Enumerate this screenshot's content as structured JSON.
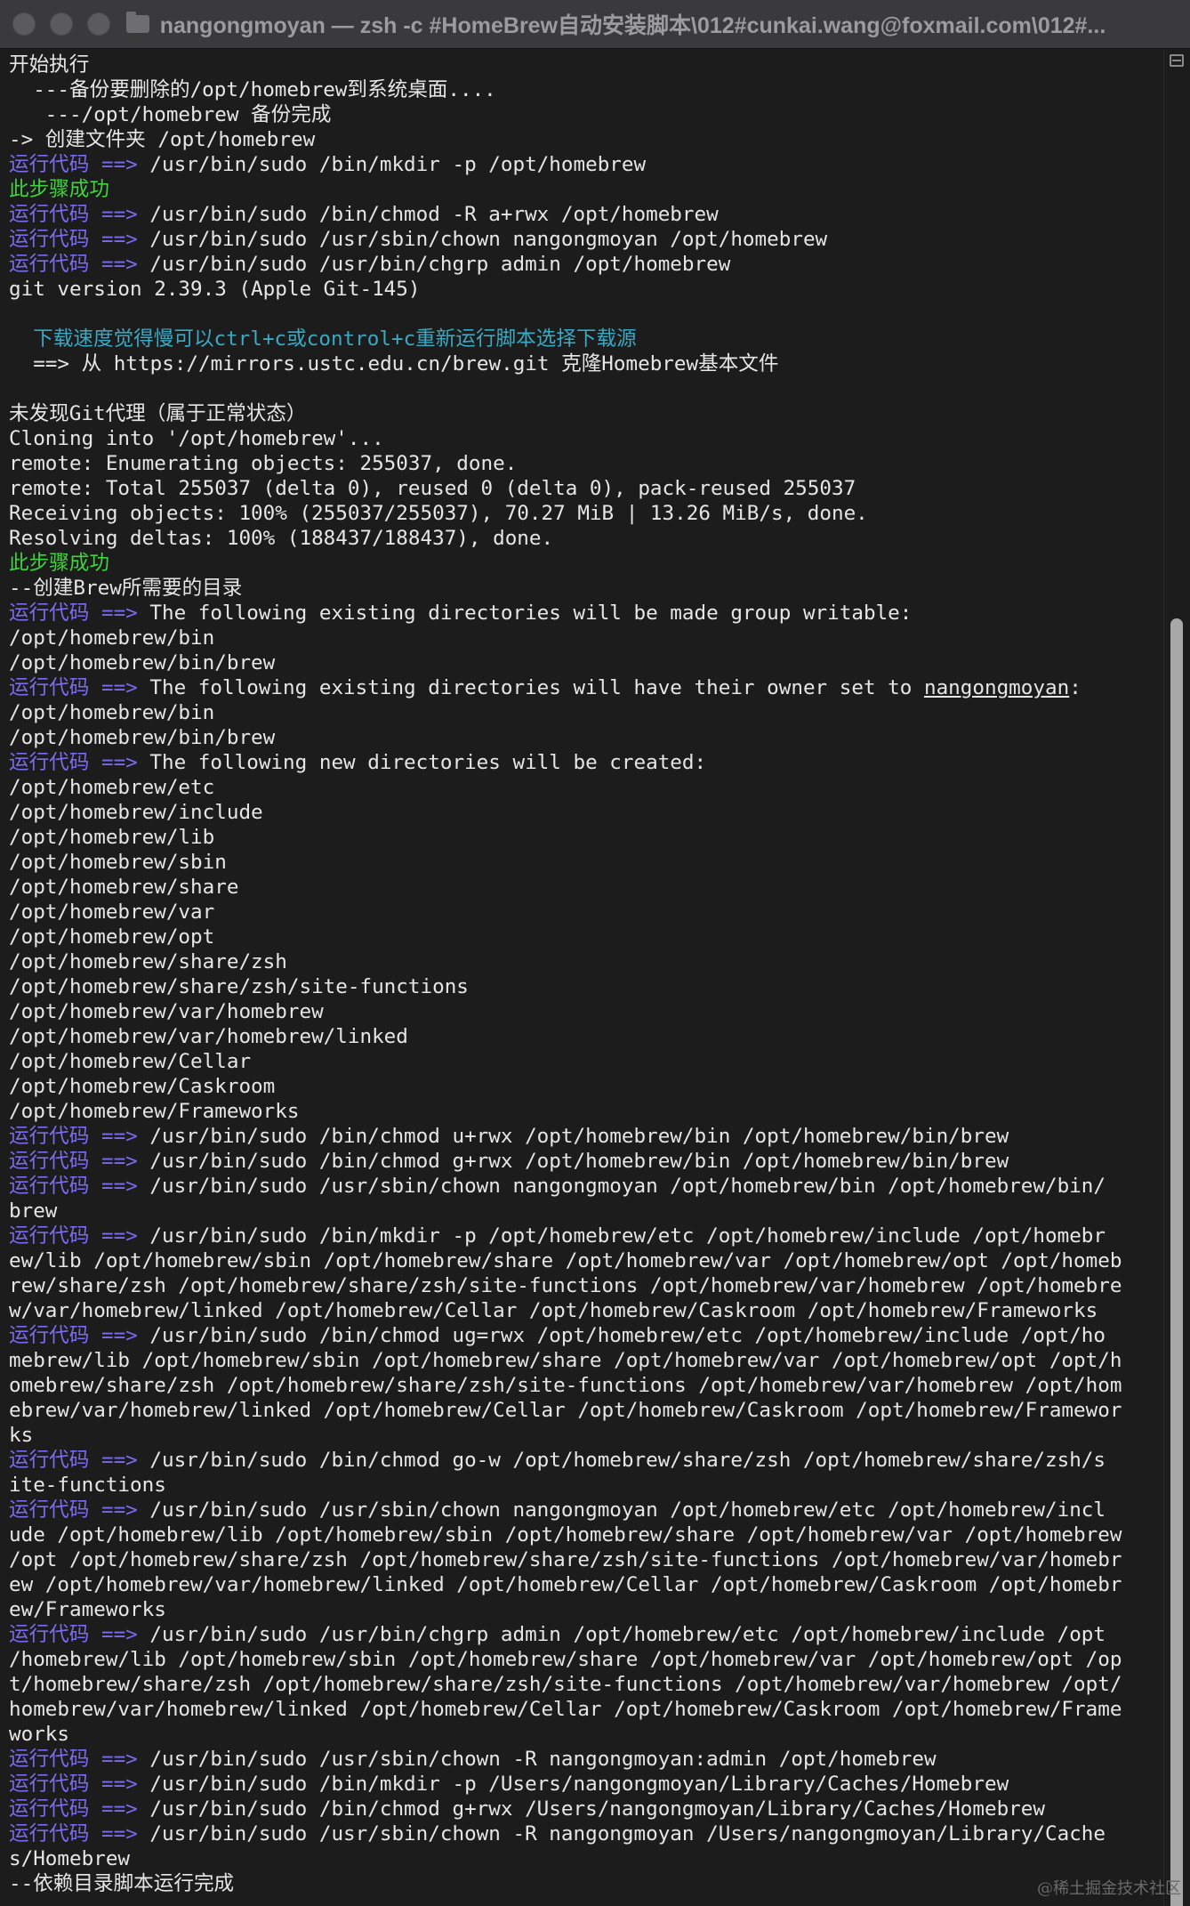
{
  "window": {
    "title": "nangongmoyan — zsh -c #HomeBrew自动安装脚本\\012#cunkai.wang@foxmail.com\\012#..."
  },
  "terminal": {
    "prompt_label": "运行代码 ==>",
    "lines": [
      [
        {
          "t": "开始执行",
          "c": "w"
        }
      ],
      [
        {
          "t": "  ---备份要删除的/opt/homebrew到系统桌面....",
          "c": "w"
        }
      ],
      [
        {
          "t": "   ---/opt/homebrew 备份完成",
          "c": "w"
        }
      ],
      [
        {
          "t": "-> 创建文件夹 /opt/homebrew",
          "c": "w"
        }
      ],
      [
        {
          "t": "运行代码 ==>",
          "c": "p"
        },
        {
          "t": " /usr/bin/sudo /bin/mkdir -p /opt/homebrew",
          "c": "w"
        }
      ],
      [
        {
          "t": "此步骤成功",
          "c": "g"
        }
      ],
      [
        {
          "t": "运行代码 ==>",
          "c": "p"
        },
        {
          "t": " /usr/bin/sudo /bin/chmod -R a+rwx /opt/homebrew",
          "c": "w"
        }
      ],
      [
        {
          "t": "运行代码 ==>",
          "c": "p"
        },
        {
          "t": " /usr/bin/sudo /usr/sbin/chown nangongmoyan /opt/homebrew",
          "c": "w"
        }
      ],
      [
        {
          "t": "运行代码 ==>",
          "c": "p"
        },
        {
          "t": " /usr/bin/sudo /usr/bin/chgrp admin /opt/homebrew",
          "c": "w"
        }
      ],
      [
        {
          "t": "git version 2.39.3 (Apple Git-145)",
          "c": "w"
        }
      ],
      [
        {
          "t": "",
          "c": "w"
        }
      ],
      [
        {
          "t": "  下载速度觉得慢可以ctrl+c或control+c重新运行脚本选择下载源",
          "c": "c"
        }
      ],
      [
        {
          "t": "  ==> 从 https://mirrors.ustc.edu.cn/brew.git 克隆Homebrew基本文件",
          "c": "w"
        }
      ],
      [
        {
          "t": "",
          "c": "w"
        }
      ],
      [
        {
          "t": "未发现Git代理（属于正常状态）",
          "c": "w"
        }
      ],
      [
        {
          "t": "Cloning into '/opt/homebrew'...",
          "c": "w"
        }
      ],
      [
        {
          "t": "remote: Enumerating objects: 255037, done.",
          "c": "w"
        }
      ],
      [
        {
          "t": "remote: Total 255037 (delta 0), reused 0 (delta 0), pack-reused 255037",
          "c": "w"
        }
      ],
      [
        {
          "t": "Receiving objects: 100% (255037/255037), 70.27 MiB | 13.26 MiB/s, done.",
          "c": "w"
        }
      ],
      [
        {
          "t": "Resolving deltas: 100% (188437/188437), done.",
          "c": "w"
        }
      ],
      [
        {
          "t": "此步骤成功",
          "c": "g"
        }
      ],
      [
        {
          "t": "--创建Brew所需要的目录",
          "c": "w"
        }
      ],
      [
        {
          "t": "运行代码 ==>",
          "c": "p"
        },
        {
          "t": " The following existing directories will be made group writable:",
          "c": "w"
        }
      ],
      [
        {
          "t": "/opt/homebrew/bin",
          "c": "w"
        }
      ],
      [
        {
          "t": "/opt/homebrew/bin/brew",
          "c": "w"
        }
      ],
      [
        {
          "t": "运行代码 ==>",
          "c": "p"
        },
        {
          "t": " The following existing directories will have their owner set to ",
          "c": "w"
        },
        {
          "t": "nangongmoyan",
          "c": "u"
        },
        {
          "t": ":",
          "c": "w"
        }
      ],
      [
        {
          "t": "/opt/homebrew/bin",
          "c": "w"
        }
      ],
      [
        {
          "t": "/opt/homebrew/bin/brew",
          "c": "w"
        }
      ],
      [
        {
          "t": "运行代码 ==>",
          "c": "p"
        },
        {
          "t": " The following new directories will be created:",
          "c": "w"
        }
      ],
      [
        {
          "t": "/opt/homebrew/etc",
          "c": "w"
        }
      ],
      [
        {
          "t": "/opt/homebrew/include",
          "c": "w"
        }
      ],
      [
        {
          "t": "/opt/homebrew/lib",
          "c": "w"
        }
      ],
      [
        {
          "t": "/opt/homebrew/sbin",
          "c": "w"
        }
      ],
      [
        {
          "t": "/opt/homebrew/share",
          "c": "w"
        }
      ],
      [
        {
          "t": "/opt/homebrew/var",
          "c": "w"
        }
      ],
      [
        {
          "t": "/opt/homebrew/opt",
          "c": "w"
        }
      ],
      [
        {
          "t": "/opt/homebrew/share/zsh",
          "c": "w"
        }
      ],
      [
        {
          "t": "/opt/homebrew/share/zsh/site-functions",
          "c": "w"
        }
      ],
      [
        {
          "t": "/opt/homebrew/var/homebrew",
          "c": "w"
        }
      ],
      [
        {
          "t": "/opt/homebrew/var/homebrew/linked",
          "c": "w"
        }
      ],
      [
        {
          "t": "/opt/homebrew/Cellar",
          "c": "w"
        }
      ],
      [
        {
          "t": "/opt/homebrew/Caskroom",
          "c": "w"
        }
      ],
      [
        {
          "t": "/opt/homebrew/Frameworks",
          "c": "w"
        }
      ],
      [
        {
          "t": "运行代码 ==>",
          "c": "p"
        },
        {
          "t": " /usr/bin/sudo /bin/chmod u+rwx /opt/homebrew/bin /opt/homebrew/bin/brew",
          "c": "w"
        }
      ],
      [
        {
          "t": "运行代码 ==>",
          "c": "p"
        },
        {
          "t": " /usr/bin/sudo /bin/chmod g+rwx /opt/homebrew/bin /opt/homebrew/bin/brew",
          "c": "w"
        }
      ],
      [
        {
          "t": "运行代码 ==>",
          "c": "p"
        },
        {
          "t": " /usr/bin/sudo /usr/sbin/chown nangongmoyan /opt/homebrew/bin /opt/homebrew/bin/",
          "c": "w"
        }
      ],
      [
        {
          "t": "brew",
          "c": "w"
        }
      ],
      [
        {
          "t": "运行代码 ==>",
          "c": "p"
        },
        {
          "t": " /usr/bin/sudo /bin/mkdir -p /opt/homebrew/etc /opt/homebrew/include /opt/homebr",
          "c": "w"
        }
      ],
      [
        {
          "t": "ew/lib /opt/homebrew/sbin /opt/homebrew/share /opt/homebrew/var /opt/homebrew/opt /opt/homeb",
          "c": "w"
        }
      ],
      [
        {
          "t": "rew/share/zsh /opt/homebrew/share/zsh/site-functions /opt/homebrew/var/homebrew /opt/homebre",
          "c": "w"
        }
      ],
      [
        {
          "t": "w/var/homebrew/linked /opt/homebrew/Cellar /opt/homebrew/Caskroom /opt/homebrew/Frameworks",
          "c": "w"
        }
      ],
      [
        {
          "t": "运行代码 ==>",
          "c": "p"
        },
        {
          "t": " /usr/bin/sudo /bin/chmod ug=rwx /opt/homebrew/etc /opt/homebrew/include /opt/ho",
          "c": "w"
        }
      ],
      [
        {
          "t": "mebrew/lib /opt/homebrew/sbin /opt/homebrew/share /opt/homebrew/var /opt/homebrew/opt /opt/h",
          "c": "w"
        }
      ],
      [
        {
          "t": "omebrew/share/zsh /opt/homebrew/share/zsh/site-functions /opt/homebrew/var/homebrew /opt/hom",
          "c": "w"
        }
      ],
      [
        {
          "t": "ebrew/var/homebrew/linked /opt/homebrew/Cellar /opt/homebrew/Caskroom /opt/homebrew/Framewor",
          "c": "w"
        }
      ],
      [
        {
          "t": "ks",
          "c": "w"
        }
      ],
      [
        {
          "t": "运行代码 ==>",
          "c": "p"
        },
        {
          "t": " /usr/bin/sudo /bin/chmod go-w /opt/homebrew/share/zsh /opt/homebrew/share/zsh/s",
          "c": "w"
        }
      ],
      [
        {
          "t": "ite-functions",
          "c": "w"
        }
      ],
      [
        {
          "t": "运行代码 ==>",
          "c": "p"
        },
        {
          "t": " /usr/bin/sudo /usr/sbin/chown nangongmoyan /opt/homebrew/etc /opt/homebrew/incl",
          "c": "w"
        }
      ],
      [
        {
          "t": "ude /opt/homebrew/lib /opt/homebrew/sbin /opt/homebrew/share /opt/homebrew/var /opt/homebrew",
          "c": "w"
        }
      ],
      [
        {
          "t": "/opt /opt/homebrew/share/zsh /opt/homebrew/share/zsh/site-functions /opt/homebrew/var/homebr",
          "c": "w"
        }
      ],
      [
        {
          "t": "ew /opt/homebrew/var/homebrew/linked /opt/homebrew/Cellar /opt/homebrew/Caskroom /opt/homebr",
          "c": "w"
        }
      ],
      [
        {
          "t": "ew/Frameworks",
          "c": "w"
        }
      ],
      [
        {
          "t": "运行代码 ==>",
          "c": "p"
        },
        {
          "t": " /usr/bin/sudo /usr/bin/chgrp admin /opt/homebrew/etc /opt/homebrew/include /opt",
          "c": "w"
        }
      ],
      [
        {
          "t": "/homebrew/lib /opt/homebrew/sbin /opt/homebrew/share /opt/homebrew/var /opt/homebrew/opt /op",
          "c": "w"
        }
      ],
      [
        {
          "t": "t/homebrew/share/zsh /opt/homebrew/share/zsh/site-functions /opt/homebrew/var/homebrew /opt/",
          "c": "w"
        }
      ],
      [
        {
          "t": "homebrew/var/homebrew/linked /opt/homebrew/Cellar /opt/homebrew/Caskroom /opt/homebrew/Frame",
          "c": "w"
        }
      ],
      [
        {
          "t": "works",
          "c": "w"
        }
      ],
      [
        {
          "t": "运行代码 ==>",
          "c": "p"
        },
        {
          "t": " /usr/bin/sudo /usr/sbin/chown -R nangongmoyan:admin /opt/homebrew",
          "c": "w"
        }
      ],
      [
        {
          "t": "运行代码 ==>",
          "c": "p"
        },
        {
          "t": " /usr/bin/sudo /bin/mkdir -p /Users/nangongmoyan/Library/Caches/Homebrew",
          "c": "w"
        }
      ],
      [
        {
          "t": "运行代码 ==>",
          "c": "p"
        },
        {
          "t": " /usr/bin/sudo /bin/chmod g+rwx /Users/nangongmoyan/Library/Caches/Homebrew",
          "c": "w"
        }
      ],
      [
        {
          "t": "运行代码 ==>",
          "c": "p"
        },
        {
          "t": " /usr/bin/sudo /usr/sbin/chown -R nangongmoyan /Users/nangongmoyan/Library/Cache",
          "c": "w"
        }
      ],
      [
        {
          "t": "s/Homebrew",
          "c": "w"
        }
      ],
      [
        {
          "t": "--依赖目录脚本运行完成",
          "c": "w"
        }
      ]
    ]
  },
  "watermark": "@稀土掘金技术社区",
  "colors": {
    "background": "#1c1c1c",
    "text": "#e6e6e6",
    "prompt": "#7a6cf0",
    "success": "#3fd33f",
    "hint": "#39a9c4"
  }
}
